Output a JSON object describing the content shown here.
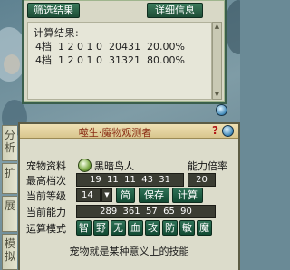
{
  "result_panel": {
    "filter_button": "筛选结果",
    "detail_button": "详细信息",
    "title": "计算结果:",
    "rows": [
      "4档  1 2 0 1 0  20431  20.00%",
      "4档  1 2 0 1 0  31321  80.00%"
    ]
  },
  "side_tabs": [
    "分",
    "析",
    "扩",
    "展",
    "模",
    "拟"
  ],
  "main_panel": {
    "title": "噬生·魔物观测者",
    "help": "?",
    "pet_label": "宠物资料",
    "pet_name": "黑暗鸟人",
    "multiplier_label": "能力倍率",
    "max_tier_label": "最高档次",
    "max_tier_value": "19  11  11  43  31",
    "multiplier_value": "20",
    "level_label": "当前等级",
    "level_value": "14",
    "btn_simple": "简",
    "btn_save": "保存",
    "btn_calc": "计算",
    "power_label": "当前能力",
    "power_value": "289  361  57  65  90",
    "mode_label": "运算模式",
    "modes": [
      "智",
      "野",
      "无",
      "血",
      "攻",
      "防",
      "敏",
      "魔"
    ],
    "footer": "宠物就是某种意义上的技能"
  }
}
